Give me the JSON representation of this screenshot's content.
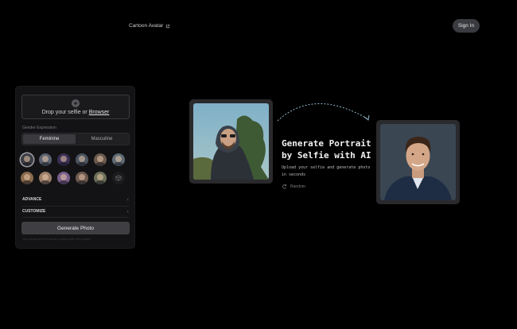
{
  "header": {
    "nav_link_label": "Cartoon Avatar",
    "signin_label": "Sign In"
  },
  "panel": {
    "dropzone": {
      "text": "Drop your selfie or ",
      "link": "Browser"
    },
    "gender_label": "Gender Expression",
    "gender_options": [
      "Feminine",
      "Masculine"
    ],
    "gender_selected": "Feminine",
    "avatars": [
      {
        "color": "#3a3d44"
      },
      {
        "color": "#5a6270"
      },
      {
        "color": "#3b2f55"
      },
      {
        "color": "#4a5360"
      },
      {
        "color": "#6b5a4e"
      },
      {
        "color": "#5e6a74"
      },
      {
        "color": "#8a6a4c"
      },
      {
        "color": "#9a7d68"
      },
      {
        "color": "#7a5f8a"
      },
      {
        "color": "#6e5a50"
      },
      {
        "color": "#6a7058"
      }
    ],
    "advance_label": "ADVANCE",
    "customize_label": "CUSTOMIZE",
    "generate_label": "Generate Photo",
    "footnote": "Your photos won't be stored or shared with third parties"
  },
  "hero": {
    "title_line1": "Generate Portrait",
    "title_line2": "by Selfie with AI",
    "sub_line1": "Upload your selfie and generate photo",
    "sub_line2": "in seconds",
    "random_label": "Random"
  },
  "colors": {
    "background": "#000000",
    "panel": "#131315",
    "accent_dash": "#8fb8c8"
  }
}
